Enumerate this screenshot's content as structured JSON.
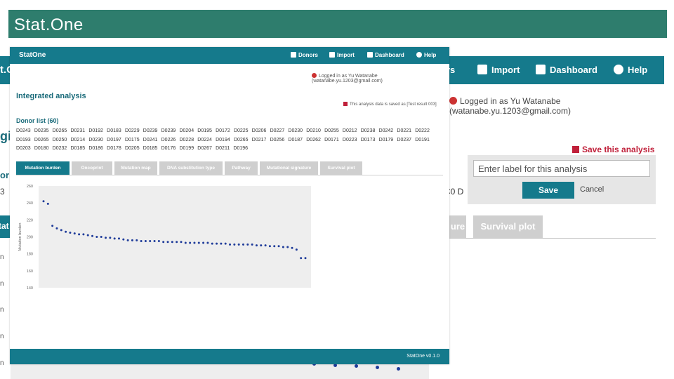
{
  "slide": {
    "title": "Stat.One"
  },
  "background": {
    "nav_left_fragment": "t.O",
    "nav_items": [
      {
        "label": "rs",
        "icon": "list-icon"
      },
      {
        "label": "Import",
        "icon": "import-icon"
      },
      {
        "label": "Dashboard",
        "icon": "dashboard-icon"
      },
      {
        "label": "Help",
        "icon": "help-icon"
      }
    ],
    "login_text": "Logged in as Yu Watanabe (watanabe.yu.1203@gmail.com)",
    "fragments": {
      "g": "gi",
      "or": "or",
      "b": "3",
      "tat": "tat",
      "c0": "C0  D"
    },
    "save_link": "Save this analysis",
    "save_input_placeholder": "Enter label for this analysis",
    "save_button": "Save",
    "cancel_button": "Cancel",
    "tabs": [
      {
        "label": "ure"
      },
      {
        "label": "Survival plot"
      }
    ],
    "y_fragments": [
      "n",
      "n",
      "n",
      "n",
      "n"
    ]
  },
  "app": {
    "brand": "StatOne",
    "nav": [
      {
        "label": "Donors",
        "icon": "list-icon"
      },
      {
        "label": "Import",
        "icon": "import-icon"
      },
      {
        "label": "Dashboard",
        "icon": "dashboard-icon"
      },
      {
        "label": "Help",
        "icon": "help-icon"
      }
    ],
    "login_text": "Logged in as Yu Watanabe (watanabe.yu.1203@gmail.com)",
    "page_title": "Integrated analysis",
    "saved_note": "This analysis data is saved as [Test result 003]",
    "donor_list_title": "Donor list (60)",
    "donors": [
      "D0243",
      "D0235",
      "D0265",
      "D0231",
      "D0192",
      "D0183",
      "D0229",
      "D0239",
      "D0239",
      "D0204",
      "D0195",
      "D0172",
      "D0225",
      "D0206",
      "D0227",
      "D0230",
      "D0210",
      "D0255",
      "D0212",
      "D0238",
      "D0242",
      "D0221",
      "D0222",
      "D0193",
      "D0265",
      "D0250",
      "D0214",
      "D0230",
      "D0197",
      "D0175",
      "D0241",
      "D0226",
      "D0228",
      "D0224",
      "D0194",
      "D0265",
      "D0217",
      "D0256",
      "D0187",
      "D0262",
      "D0171",
      "D0223",
      "D0173",
      "D0179",
      "D0237",
      "D0191",
      "D0203",
      "D0180",
      "D0232",
      "D0185",
      "D0186",
      "D0178",
      "D0205",
      "D0185",
      "D0176",
      "D0199",
      "D0267",
      "D0211",
      "D0196"
    ],
    "tabs": [
      {
        "label": "Mutation burden",
        "active": true
      },
      {
        "label": "Oncoprint",
        "active": false
      },
      {
        "label": "Mutation map",
        "active": false
      },
      {
        "label": "DNA substitution type",
        "active": false
      },
      {
        "label": "Pathway",
        "active": false
      },
      {
        "label": "Mutational signature",
        "active": false
      },
      {
        "label": "Survival plot",
        "active": false
      }
    ],
    "footer": "StatOne v0.1.0"
  },
  "chart_data": {
    "type": "scatter",
    "title": "",
    "xlabel": "",
    "ylabel": "Mutation burden",
    "ylim": [
      140,
      260
    ],
    "yticks": [
      140,
      160,
      180,
      200,
      220,
      240,
      260
    ],
    "grid": false,
    "color": "#1f3c9a",
    "values": [
      242,
      239,
      213,
      210,
      208,
      206,
      205,
      204,
      203,
      203,
      202,
      201,
      200,
      200,
      199,
      199,
      198,
      198,
      197,
      196,
      196,
      196,
      195,
      195,
      195,
      195,
      195,
      194,
      194,
      194,
      194,
      194,
      193,
      193,
      193,
      193,
      193,
      193,
      192,
      192,
      192,
      192,
      191,
      191,
      191,
      191,
      191,
      191,
      190,
      190,
      190,
      189,
      189,
      189,
      188,
      188,
      187,
      185,
      175,
      175
    ]
  }
}
